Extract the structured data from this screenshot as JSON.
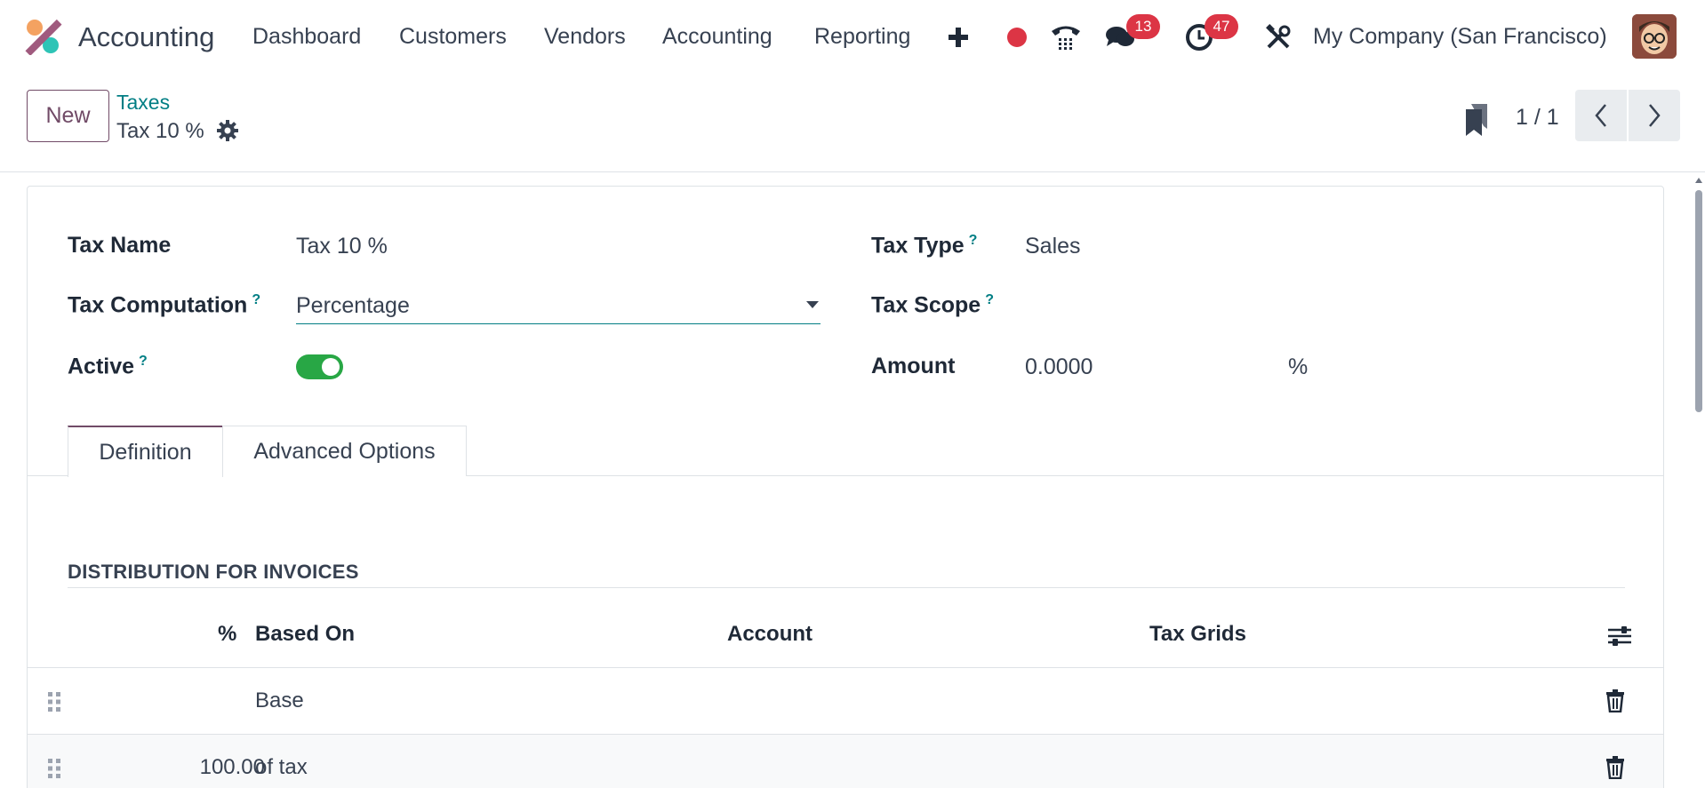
{
  "navbar": {
    "app_name": "Accounting",
    "menu": [
      "Dashboard",
      "Customers",
      "Vendors",
      "Accounting",
      "Reporting"
    ],
    "messages_count": "13",
    "activities_count": "47",
    "company": "My Company (San Francisco)",
    "icons": [
      "plus-icon",
      "record-icon",
      "phone-icon",
      "chat-icon",
      "clock-icon",
      "tools-icon"
    ]
  },
  "control": {
    "new_label": "New",
    "breadcrumb_parent": "Taxes",
    "breadcrumb_current": "Tax 10 %",
    "pager": "1 / 1"
  },
  "form": {
    "tax_name_label": "Tax Name",
    "tax_name_value": "Tax 10 %",
    "tax_computation_label": "Tax Computation",
    "tax_computation_value": "Percentage",
    "active_label": "Active",
    "active_value": true,
    "tax_type_label": "Tax Type",
    "tax_type_value": "Sales",
    "tax_scope_label": "Tax Scope",
    "amount_label": "Amount",
    "amount_value": "0.0000",
    "amount_unit": "%",
    "help_mark": "?"
  },
  "tabs": [
    "Definition",
    "Advanced Options"
  ],
  "distribution": {
    "title": "DISTRIBUTION FOR INVOICES",
    "columns": [
      "%",
      "Based On",
      "Account",
      "Tax Grids"
    ],
    "rows": [
      {
        "percent": "",
        "based_on": "Base"
      },
      {
        "percent": "100.00",
        "based_on": "of tax"
      }
    ]
  },
  "colors": {
    "brand": "#714b67",
    "link": "#017e84",
    "badge": "#dc3545",
    "toggle_on": "#28a745"
  }
}
